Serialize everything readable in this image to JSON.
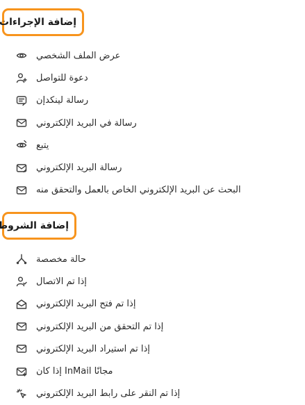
{
  "accent_color": "#f7941d",
  "actions": {
    "title": "إضافة الإجراءات",
    "items": [
      {
        "label": "عرض الملف الشخصي",
        "icon": "eye-icon"
      },
      {
        "label": "دعوة للتواصل",
        "icon": "add-person-icon"
      },
      {
        "label": "رسالة لينكدإن",
        "icon": "chat-message-icon"
      },
      {
        "label": "رسالة في البريد الإلكتروني",
        "icon": "mail-send-icon"
      },
      {
        "label": "يتبع",
        "icon": "follow-eye-icon"
      },
      {
        "label": "رسالة البريد الإلكتروني",
        "icon": "mail-send-icon"
      },
      {
        "label": "البحث عن البريد الإلكتروني الخاص بالعمل والتحقق منه",
        "icon": "mail-check-icon"
      }
    ]
  },
  "conditions": {
    "title": "إضافة الشروط",
    "items": [
      {
        "label": "حالة مخصصة",
        "icon": "branch-icon"
      },
      {
        "label": "إذا تم الاتصال",
        "icon": "person-check-icon"
      },
      {
        "label": "إذا تم فتح البريد الإلكتروني",
        "icon": "mail-open-icon"
      },
      {
        "label": "إذا تم التحقق من البريد الإلكتروني",
        "icon": "mail-check-icon"
      },
      {
        "label": "إذا تم استيراد البريد الإلكتروني",
        "icon": "mail-check-icon"
      },
      {
        "label": "مجانًا InMail إذا كان",
        "icon": "mail-star-icon"
      },
      {
        "label": "إذا تم النقر على رابط البريد الإلكتروني",
        "icon": "click-icon"
      }
    ]
  }
}
